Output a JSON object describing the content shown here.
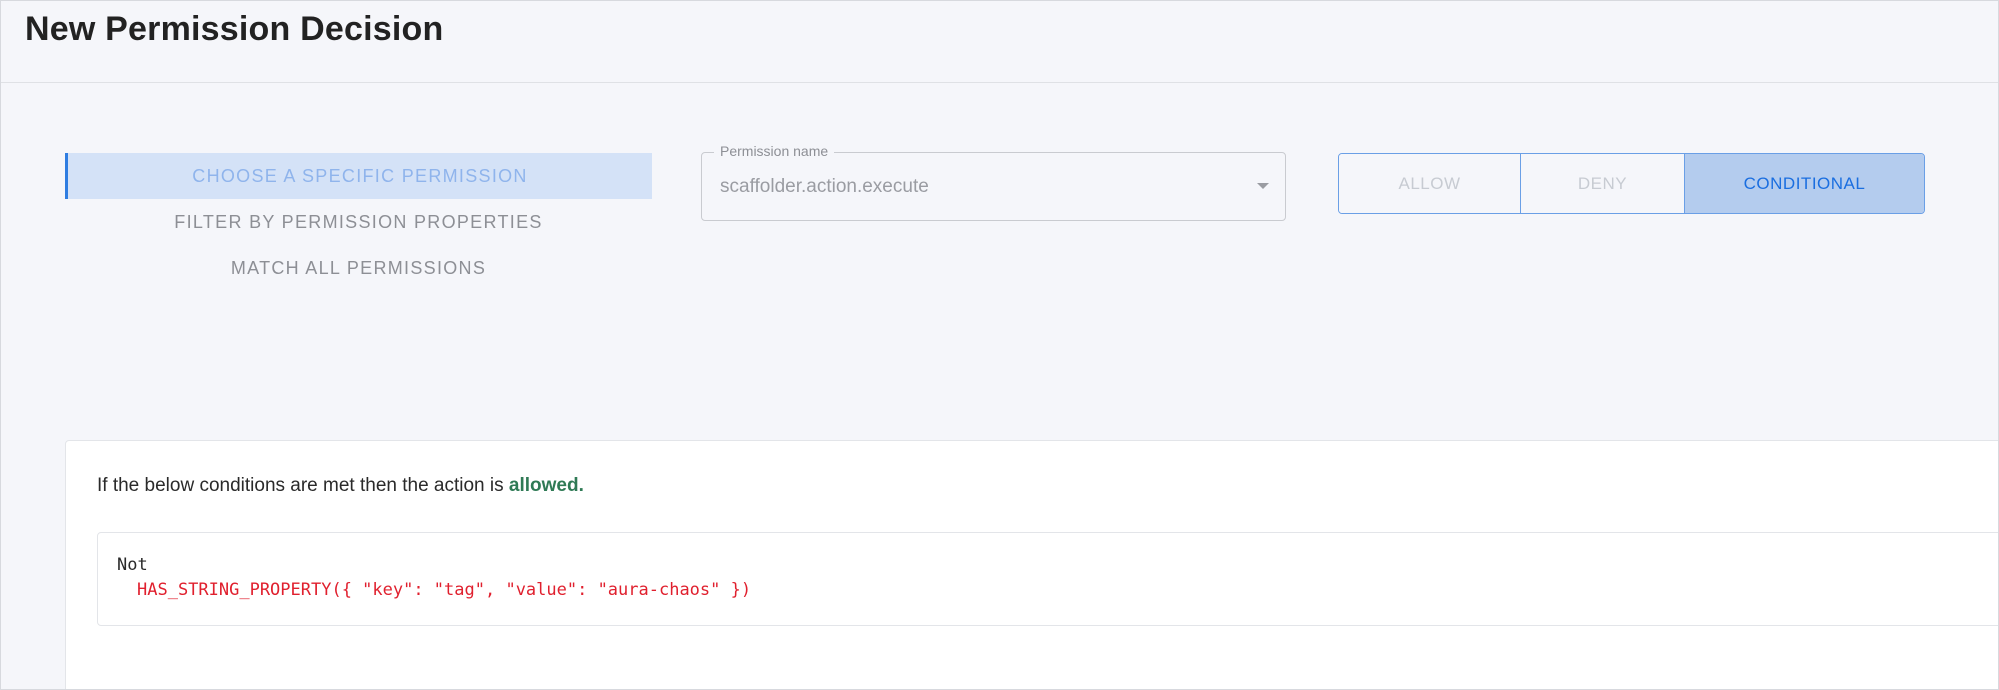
{
  "header": {
    "title": "New Permission Decision"
  },
  "tabs": [
    {
      "label": "CHOOSE A SPECIFIC PERMISSION",
      "active": true
    },
    {
      "label": "FILTER BY PERMISSION PROPERTIES",
      "active": false
    },
    {
      "label": "MATCH ALL PERMISSIONS",
      "active": false
    }
  ],
  "permission_select": {
    "label": "Permission name",
    "value": "scaffolder.action.execute"
  },
  "decision": {
    "options": [
      "ALLOW",
      "DENY",
      "CONDITIONAL"
    ],
    "selected": "CONDITIONAL"
  },
  "conditions": {
    "prefix": "If the below conditions are met then the action is ",
    "status": "allowed.",
    "operator": "Not",
    "rule": "HAS_STRING_PROPERTY({ \"key\": \"tag\", \"value\": \"aura-chaos\" })"
  },
  "colors": {
    "accent": "#2f7de1",
    "selected_toggle_bg": "#b4ccee",
    "allowed": "#2f7a55",
    "rule": "#e0202e"
  }
}
